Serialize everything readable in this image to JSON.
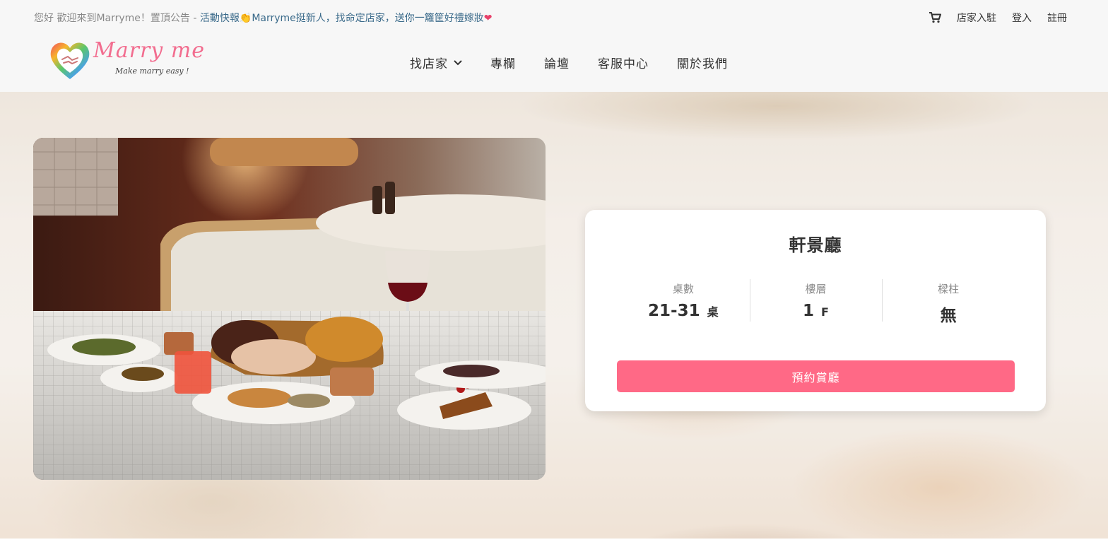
{
  "announcement": {
    "lead": "您好 歡迎來到Marryme！置頂公告 - ",
    "link": "活動快報",
    "text": "Marryme挺新人，找命定店家，送你一籮筐好禮嫁妝"
  },
  "topnav": {
    "cart_icon": "cart-icon",
    "vendor_join": "店家入駐",
    "login": "登入",
    "register": "註冊"
  },
  "logo": {
    "script": "Marry me",
    "tagline": "Make marry easy !"
  },
  "mainnav": {
    "items": [
      "找店家",
      "專欄",
      "論壇",
      "客服中心",
      "關於我們"
    ]
  },
  "venue": {
    "name": "軒景廳",
    "stats": [
      {
        "label": "桌數",
        "value": "21-31",
        "unit": "桌"
      },
      {
        "label": "樓層",
        "value": "1",
        "unit": "F"
      },
      {
        "label": "樑柱",
        "value": "無",
        "unit": ""
      }
    ],
    "book_label": "預約賞廳"
  },
  "colors": {
    "accent": "#ff6986",
    "topbar_bg": "#f7f7f7"
  }
}
